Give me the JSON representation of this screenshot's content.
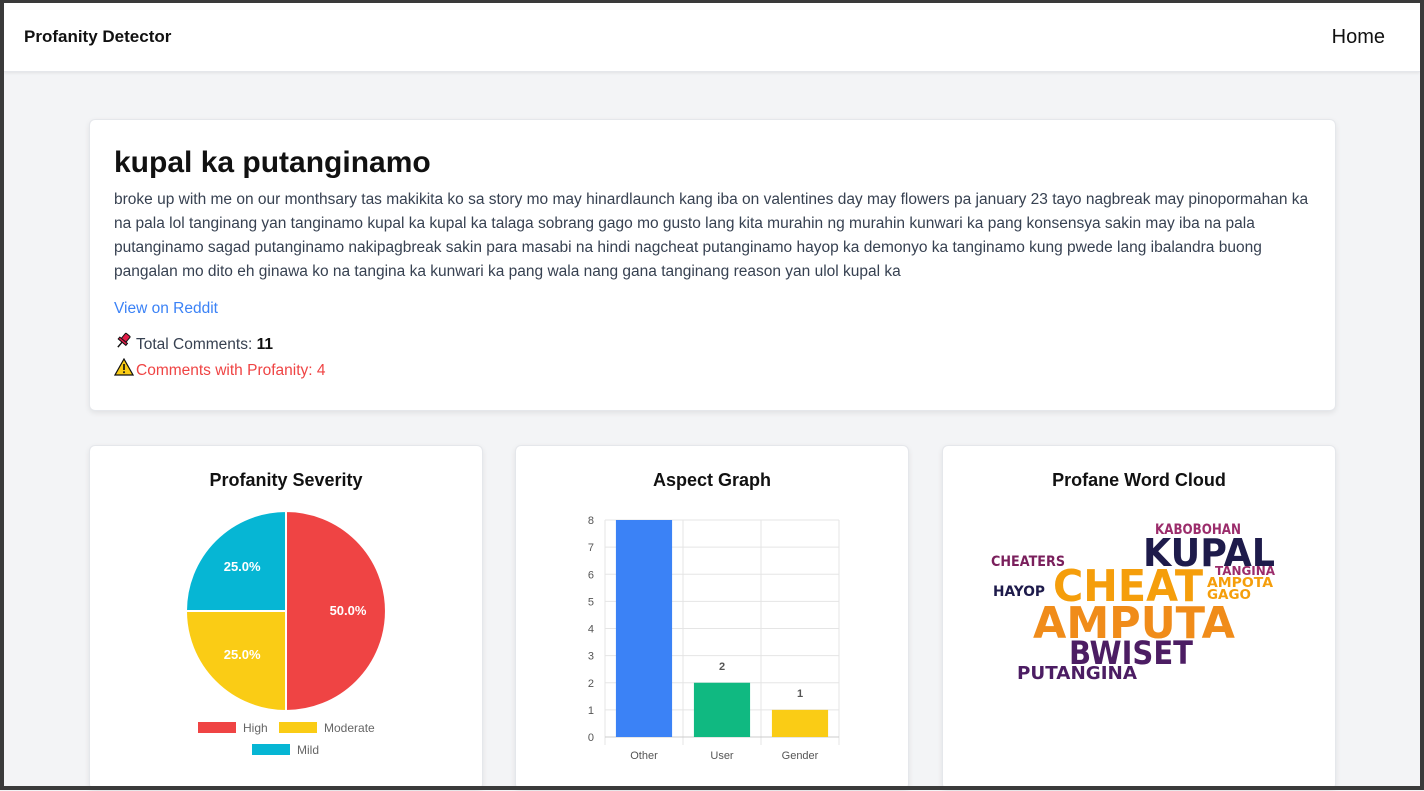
{
  "navbar": {
    "brand": "Profanity Detector",
    "home": "Home"
  },
  "post": {
    "title": "kupal ka putanginamo",
    "body": "broke up with me on our monthsary tas makikita ko sa story mo may hinardlaunch kang iba on valentines day may flowers pa january 23 tayo nagbreak may pinopormahan ka na pala lol tanginang yan tanginamo kupal ka kupal ka talaga sobrang gago mo gusto lang kita murahin ng murahin kunwari ka pang konsensya sakin may iba na pala putanginamo sagad putanginamo nakipagbreak sakin para masabi na hindi nagcheat putanginamo hayop ka demonyo ka tanginamo kung pwede lang ibalandra buong pangalan mo dito eh ginawa ko na tangina ka kunwari ka pang wala nang gana tanginang reason yan ulol kupal ka",
    "link_label": "View on Reddit",
    "total_label": "Total Comments:",
    "total_value": "11",
    "profanity_label": "Comments with Profanity: 4",
    "pin_icon": "pushpin-icon",
    "warning_icon": "warning-icon"
  },
  "severity": {
    "title": "Profanity Severity",
    "chart_data": {
      "type": "pie",
      "labels": [
        "High",
        "Moderate",
        "Mild"
      ],
      "values": [
        50.0,
        25.0,
        25.0
      ],
      "value_labels": [
        "50.0%",
        "25.0%",
        "25.0%"
      ],
      "colors": [
        "#ef4444",
        "#facc15",
        "#06b6d4"
      ],
      "legend": "bottom"
    }
  },
  "aspect": {
    "title": "Aspect Graph",
    "chart_data": {
      "type": "bar",
      "categories": [
        "Other",
        "User",
        "Gender"
      ],
      "values": [
        8,
        2,
        1
      ],
      "value_labels": [
        "",
        "2",
        "1"
      ],
      "colors": [
        "#3b82f6",
        "#10b981",
        "#facc15"
      ],
      "ylim": [
        0,
        8
      ],
      "yticks": [
        "0",
        "1",
        "2",
        "3",
        "4",
        "5",
        "6",
        "7",
        "8"
      ],
      "grid": true
    }
  },
  "cloud": {
    "title": "Profane Word Cloud",
    "words": [
      {
        "text": "KABOBOHAN",
        "color": "#9b2c6b"
      },
      {
        "text": "KUPAL",
        "color": "#1e1b4b"
      },
      {
        "text": "CHEATERS",
        "color": "#7a1f5c"
      },
      {
        "text": "TANGINA",
        "color": "#9b2c6b"
      },
      {
        "text": "CHEAT",
        "color": "#f59e0b"
      },
      {
        "text": "AMPOTA",
        "color": "#f59e0b"
      },
      {
        "text": "HAYOP",
        "color": "#1e1b4b"
      },
      {
        "text": "GAGO",
        "color": "#f59e0b"
      },
      {
        "text": "AMPUTA",
        "color": "#f08c1a"
      },
      {
        "text": "BWISET",
        "color": "#4c1d63"
      },
      {
        "text": "PUTANGINA",
        "color": "#4c1d63"
      }
    ]
  }
}
